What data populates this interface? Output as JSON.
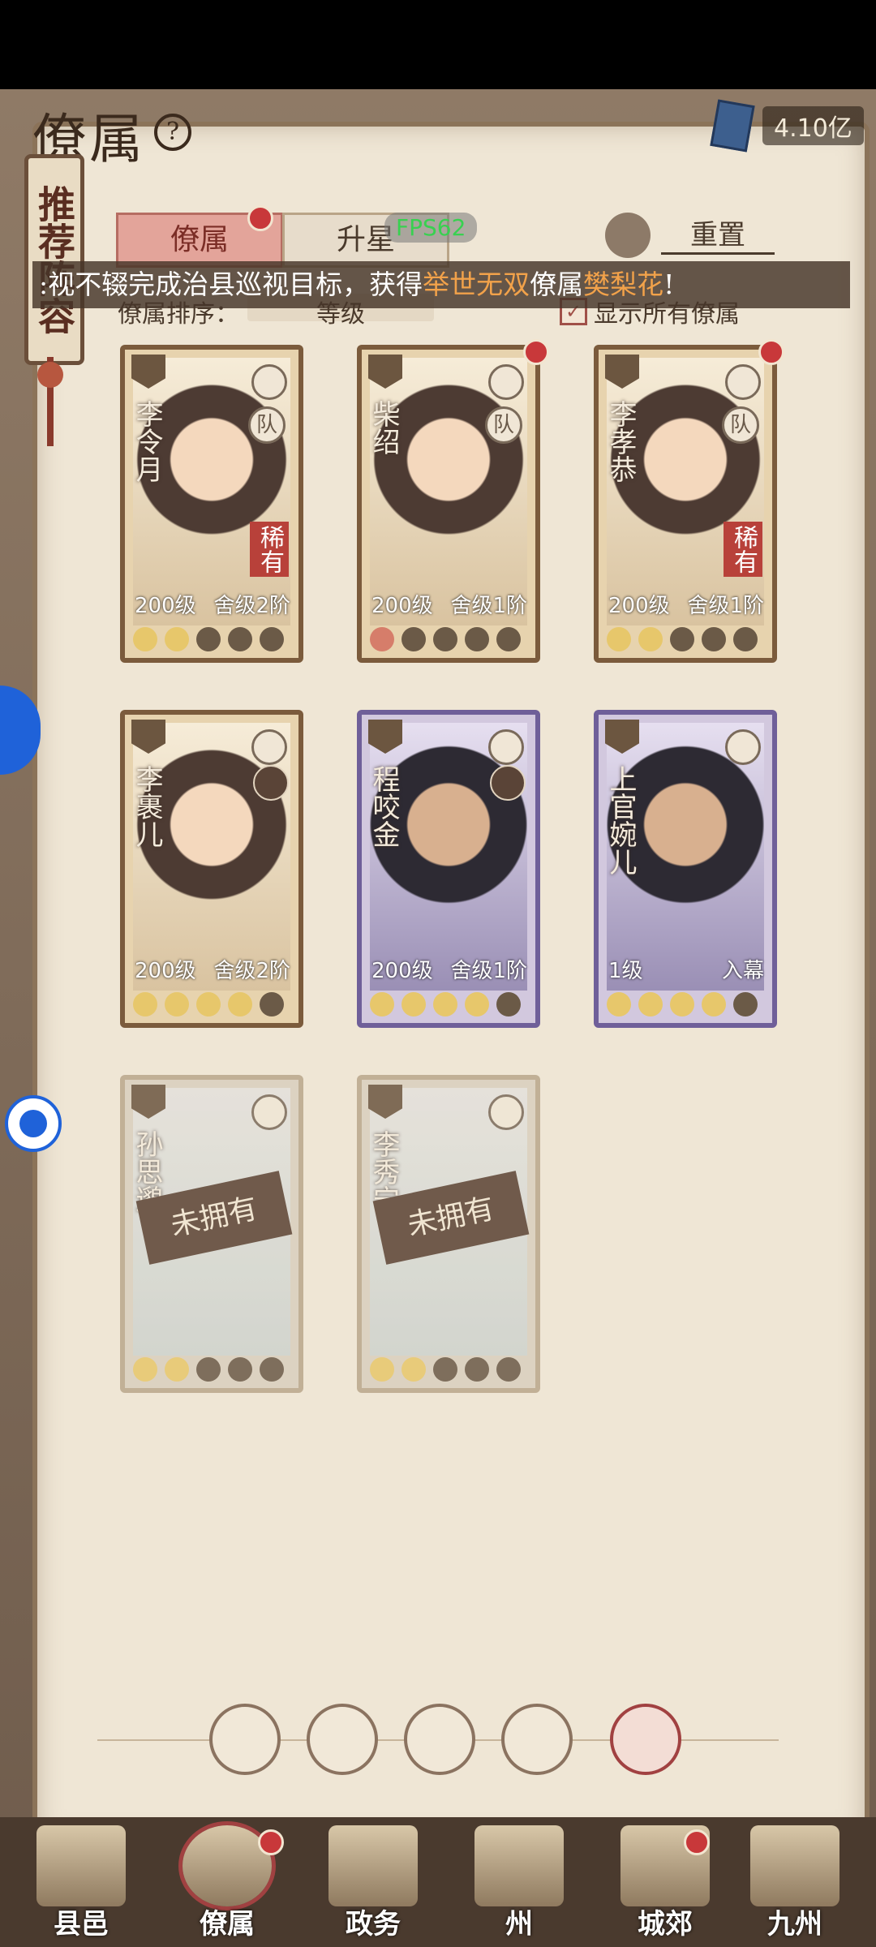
{
  "header": {
    "title": "僚属",
    "help_icon": "?",
    "currency": "4.10亿"
  },
  "recommend": "推荐阵容",
  "tabs": [
    {
      "label": "僚属"
    },
    {
      "label": "升星"
    }
  ],
  "fps": "FPS62",
  "reset_label": "重置",
  "banner": {
    "prefix": ":视不辍完成治县巡视目标，获得",
    "tag": "举世无双",
    "middle": "僚属",
    "name": "樊梨花",
    "suffix": "!"
  },
  "sort": {
    "label": "僚属排序：",
    "value": "等级",
    "show_all": "显示所有僚属",
    "checked": "✓"
  },
  "cards": [
    {
      "name": "李令月",
      "level": "200级",
      "rank": "舍级2阶",
      "team": "队",
      "rare": "稀有",
      "moons": [
        "on",
        "on",
        "off",
        "off",
        "off"
      ]
    },
    {
      "name": "柴绍",
      "level": "200级",
      "rank": "舍级1阶",
      "team": "队",
      "moons": [
        "red",
        "off",
        "off",
        "off",
        "off"
      ]
    },
    {
      "name": "李孝恭",
      "level": "200级",
      "rank": "舍级1阶",
      "team": "队",
      "rare": "稀有",
      "moons": [
        "on",
        "on",
        "off",
        "off",
        "off"
      ]
    },
    {
      "name": "李裹儿",
      "level": "200级",
      "rank": "舍级2阶",
      "moons": [
        "on",
        "on",
        "on",
        "on",
        "off"
      ]
    },
    {
      "name": "程咬金",
      "level": "200级",
      "rank": "舍级1阶",
      "moons": [
        "on",
        "on",
        "on",
        "on",
        "off"
      ]
    },
    {
      "name": "上官婉儿",
      "level": "1级",
      "rank": "入幕",
      "moons": [
        "on",
        "on",
        "on",
        "on",
        "off"
      ]
    },
    {
      "name": "孙思邈",
      "unowned": "未拥有",
      "moons": [
        "on",
        "on",
        "off",
        "off",
        "off"
      ]
    },
    {
      "name": "李秀宁",
      "unowned": "未拥有",
      "moons": [
        "on",
        "on",
        "off",
        "off",
        "off"
      ]
    }
  ],
  "nav": [
    {
      "label": "县邑"
    },
    {
      "label": "僚属"
    },
    {
      "label": "政务"
    },
    {
      "label": "州"
    },
    {
      "label": "城郊"
    },
    {
      "label": "九州"
    }
  ]
}
